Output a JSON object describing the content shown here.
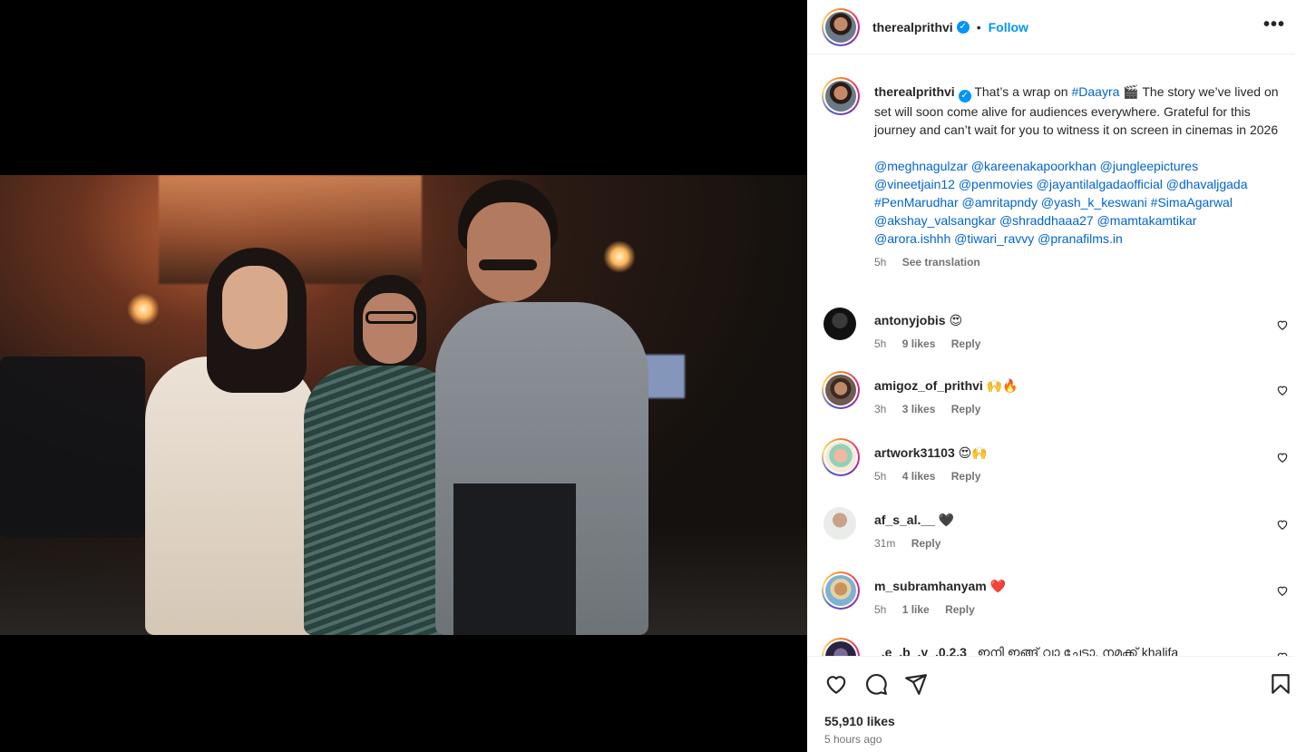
{
  "post": {
    "username": "therealprithvi",
    "follow_label": "Follow",
    "more_label": "•••",
    "dot": "•"
  },
  "caption": {
    "username": "therealprithvi",
    "text_before": "That’s a wrap on ",
    "hashtag": "#Daayra",
    "emoji": "🎬",
    "text_after": " The story we’ve lived on set will soon come alive for audiences everywhere. Grateful for this journey and can’t wait for you to witness it on screen in cinemas in 2026",
    "tags_line1": "@meghnagulzar @kareenakapoorkhan @jungleepictures",
    "tags_line2": "@vineetjain12 @penmovies @jayantilalgadaofficial @dhavaljgada",
    "tags_line3": "#PenMarudhar @amritapndy @yash_k_keswani #SimaAgarwal",
    "tags_line4": "@akshay_valsangkar @shraddhaaa27 @mamtakamtikar",
    "tags_line5": "@arora.ishhh @tiwari_ravvy @pranafilms.in",
    "time": "5h",
    "see_translation": "See translation"
  },
  "comments": [
    {
      "user": "antonyjobis",
      "text": "😍",
      "time": "5h",
      "likes": "9 likes",
      "reply": "Reply"
    },
    {
      "user": "amigoz_of_prithvi",
      "text": "🙌🔥",
      "time": "3h",
      "likes": "3 likes",
      "reply": "Reply"
    },
    {
      "user": "artwork31103",
      "text": "😍🙌",
      "time": "5h",
      "likes": "4 likes",
      "reply": "Reply"
    },
    {
      "user": "af_s_al.__",
      "text": "🖤",
      "time": "31m",
      "likes": "",
      "reply": "Reply"
    },
    {
      "user": "m_subramhanyam",
      "text": "❤️",
      "time": "5h",
      "likes": "1 like",
      "reply": "Reply"
    },
    {
      "user": "_.e_.b_.y_.0.2.3_",
      "text": "ഇനി ഇങ്ങ് വാ ചേട്ടാ, നമുക്ക് khalifa",
      "time": "",
      "likes": "",
      "reply": ""
    }
  ],
  "footer": {
    "likes": "55,910 likes",
    "time_ago": "5 hours ago"
  },
  "icons": {
    "like": "heart-icon",
    "comment": "comment-icon",
    "share": "share-icon",
    "save": "bookmark-icon"
  },
  "colors": {
    "accent": "#0095f6",
    "link": "#00376b"
  }
}
